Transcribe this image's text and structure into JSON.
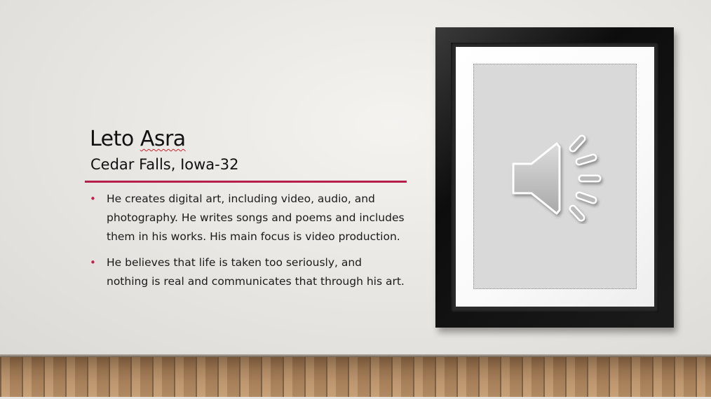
{
  "slide": {
    "title_first": "Leto",
    "title_last": "Asra",
    "subtitle": "Cedar Falls, Iowa-32",
    "accent_color": "#b5204a",
    "bullets": [
      {
        "text": "He creates digital art, including video, audio, and photography. He writes songs and poems and includes them in his works.  His main focus is video production."
      },
      {
        "text": "He believes that life is taken too seriously, and nothing is real and communicates that through his art."
      }
    ],
    "bullet_marker": "•",
    "media": {
      "icon": "speaker-audio-icon"
    }
  }
}
